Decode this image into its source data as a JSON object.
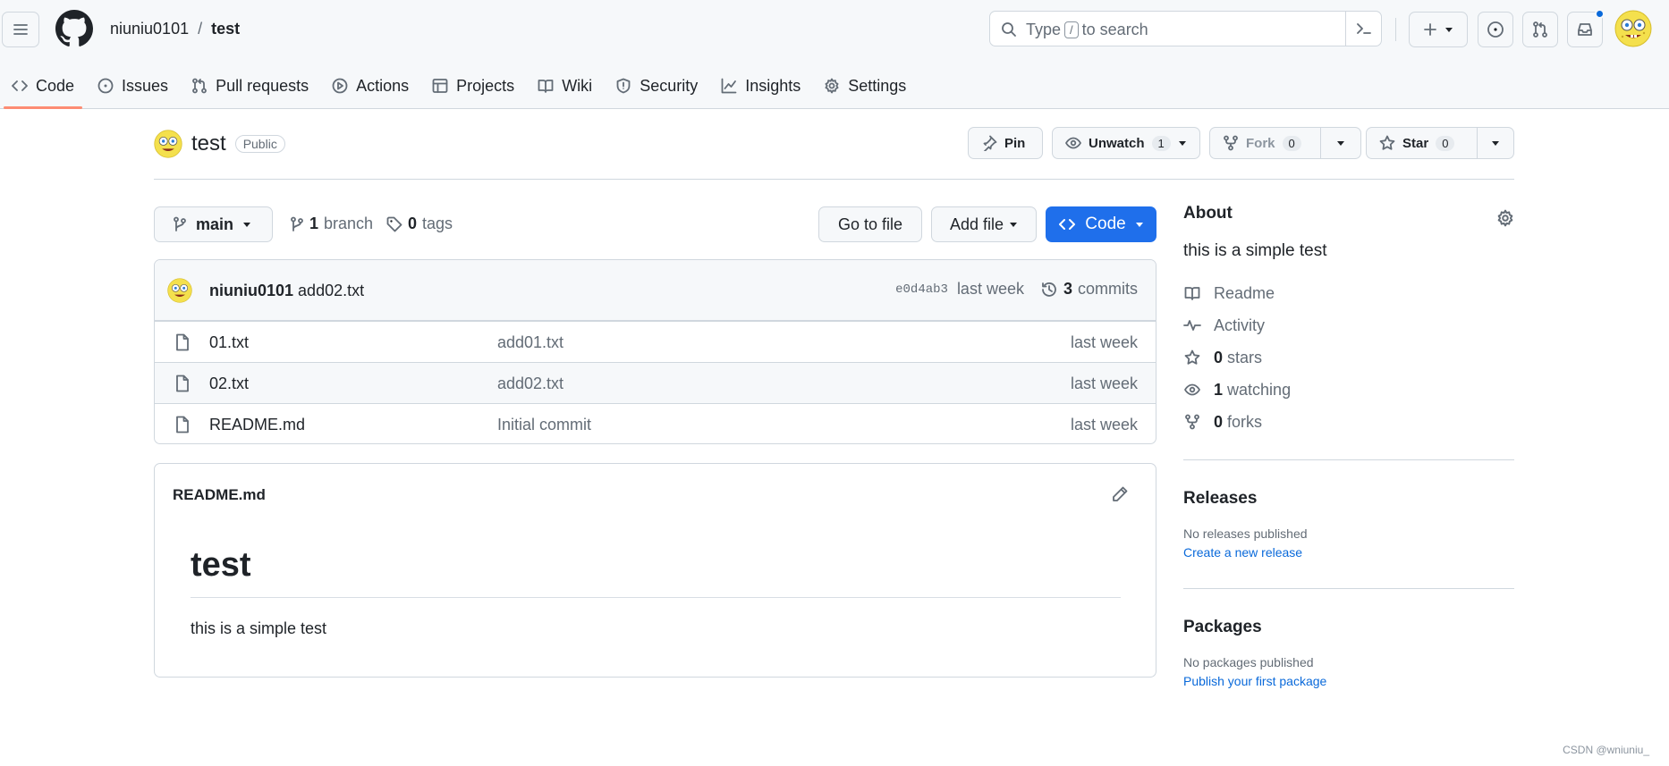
{
  "header": {
    "owner": "niuniu0101",
    "separator": "/",
    "repo": "test",
    "search_prefix": "Type",
    "search_key": "/",
    "search_suffix": "to search"
  },
  "tabs": [
    {
      "label": "Code",
      "icon": "code-icon"
    },
    {
      "label": "Issues",
      "icon": "issue-icon"
    },
    {
      "label": "Pull requests",
      "icon": "pull-request-icon"
    },
    {
      "label": "Actions",
      "icon": "play-icon"
    },
    {
      "label": "Projects",
      "icon": "table-icon"
    },
    {
      "label": "Wiki",
      "icon": "book-icon"
    },
    {
      "label": "Security",
      "icon": "shield-icon"
    },
    {
      "label": "Insights",
      "icon": "graph-icon"
    },
    {
      "label": "Settings",
      "icon": "gear-icon"
    }
  ],
  "repo_header": {
    "name": "test",
    "visibility": "Public",
    "pin": "Pin",
    "unwatch": "Unwatch",
    "watch_count": "1",
    "fork": "Fork",
    "fork_count": "0",
    "star": "Star",
    "star_count": "0"
  },
  "branch_bar": {
    "branch": "main",
    "branch_count": "1",
    "branch_word": "branch",
    "tag_count": "0",
    "tag_word": "tags",
    "go_to_file": "Go to file",
    "add_file": "Add file",
    "code": "Code"
  },
  "commit": {
    "author": "niuniu0101",
    "message": "add02.txt",
    "sha": "e0d4ab3",
    "age": "last week",
    "commit_count": "3",
    "commit_word": "commits"
  },
  "files": [
    {
      "name": "01.txt",
      "message": "add01.txt",
      "age": "last week"
    },
    {
      "name": "02.txt",
      "message": "add02.txt",
      "age": "last week"
    },
    {
      "name": "README.md",
      "message": "Initial commit",
      "age": "last week"
    }
  ],
  "readme": {
    "filename": "README.md",
    "heading": "test",
    "body": "this is a simple test"
  },
  "about": {
    "title": "About",
    "description": "this is a simple test",
    "readme": "Readme",
    "activity": "Activity",
    "stars_count": "0",
    "stars_word": "stars",
    "watching_count": "1",
    "watching_word": "watching",
    "forks_count": "0",
    "forks_word": "forks"
  },
  "releases": {
    "title": "Releases",
    "empty": "No releases published",
    "create_link": "Create a new release"
  },
  "packages": {
    "title": "Packages",
    "empty": "No packages published",
    "publish_link": "Publish your first package"
  },
  "watermark": "CSDN @wniuniu_",
  "colors": {
    "accent_tab": "#fd8c73",
    "primary_button": "#1f6feb",
    "link": "#0969da",
    "notification_dot": "#0969da"
  }
}
